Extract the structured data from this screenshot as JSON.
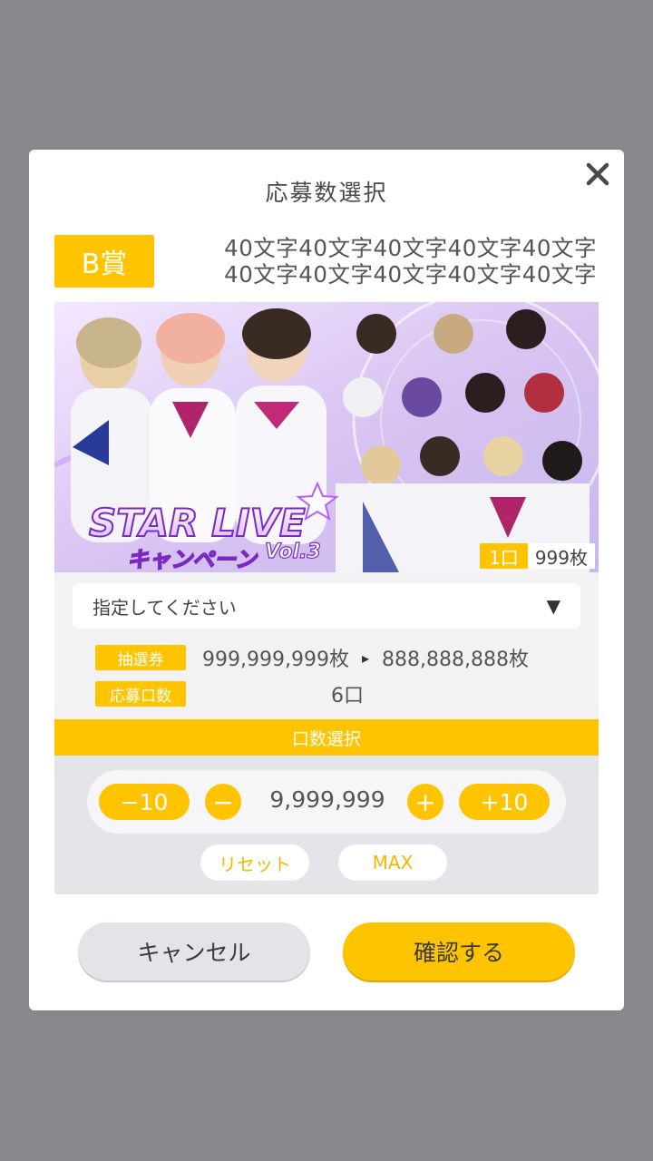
{
  "modal": {
    "title": "応募数選択"
  },
  "prize": {
    "badge": "B賞",
    "description": "40文字40文字40文字40文字40文字\n40文字40文字40文字40文字40文字"
  },
  "banner": {
    "logo_main": "STAR LIVE",
    "logo_sub": "キャンペーン",
    "logo_vol": "Vol.3",
    "stock_unit": "1口",
    "stock_count": "999枚"
  },
  "select": {
    "placeholder": "指定してください",
    "arrow": "▼"
  },
  "info": {
    "ticket_label": "抽選券",
    "ticket_from": "999,999,999枚",
    "ticket_arrow": "▸",
    "ticket_to": "888,888,888枚",
    "entries_label": "応募口数",
    "entries_value": "6口"
  },
  "counter": {
    "section_title": "口数選択",
    "minus10": "−10",
    "minus": "−",
    "value": "9,999,999",
    "plus": "+",
    "plus10": "+10",
    "reset": "リセット",
    "max": "MAX"
  },
  "actions": {
    "cancel": "キャンセル",
    "confirm": "確認する"
  },
  "colors": {
    "accent": "#ffc400",
    "backdrop": "#87888b"
  }
}
